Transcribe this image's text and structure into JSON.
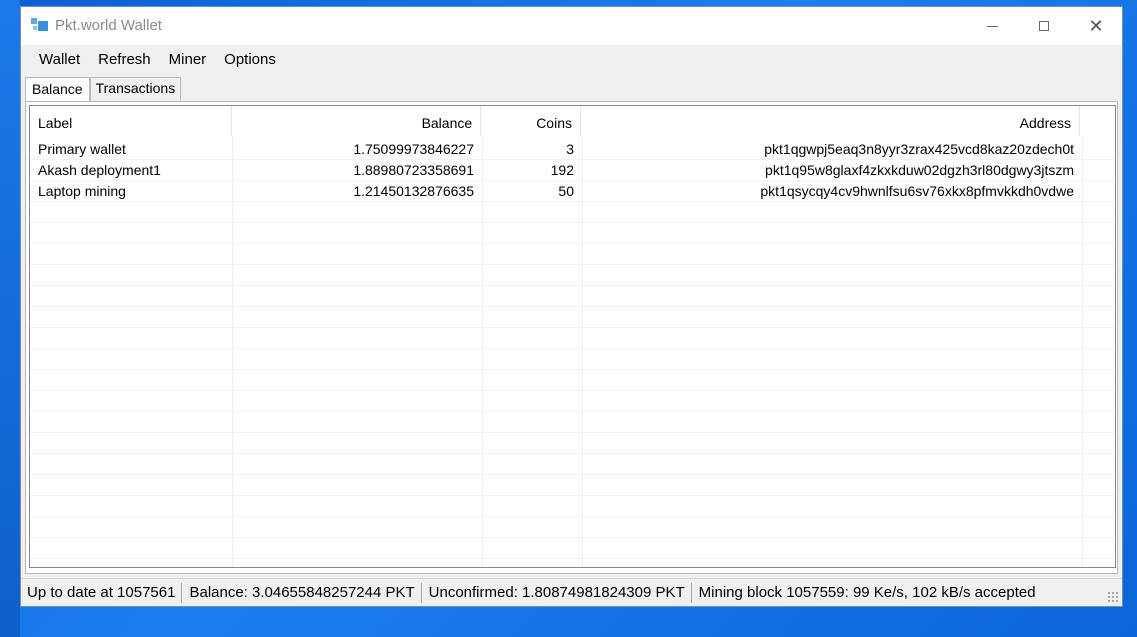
{
  "window": {
    "title": "Pkt.world Wallet"
  },
  "menu": {
    "items": [
      "Wallet",
      "Refresh",
      "Miner",
      "Options"
    ]
  },
  "tabs": [
    {
      "label": "Balance",
      "active": true
    },
    {
      "label": "Transactions",
      "active": false
    }
  ],
  "table": {
    "columns": [
      "Label",
      "Balance",
      "Coins",
      "Address"
    ],
    "rows": [
      {
        "label": "Primary wallet",
        "balance": "1.75099973846227",
        "coins": "3",
        "address": "pkt1qgwpj5eaq3n8yyr3zrax425vcd8kaz20zdech0t"
      },
      {
        "label": "Akash deployment1",
        "balance": "1.88980723358691",
        "coins": "192",
        "address": "pkt1q95w8glaxf4zkxkduw02dgzh3rl80dgwy3jtszm"
      },
      {
        "label": "Laptop mining",
        "balance": "1.21450132876635",
        "coins": "50",
        "address": "pkt1qsycqy4cv9hwnlfsu6sv76xkx8pfmvkkdh0vdwe"
      }
    ]
  },
  "status": {
    "sync": "Up to date at 1057561",
    "balance": "Balance: 3.04655848257244 PKT",
    "unconfirmed": "Unconfirmed: 1.80874981824309 PKT",
    "mining": "Mining block 1057559: 99 Ke/s, 102 kB/s accepted"
  },
  "icons": {
    "app": "wallet-app-icon",
    "minimize": "minimize-icon",
    "maximize": "maximize-icon",
    "close": "close-icon",
    "grip": "resize-grip-icon"
  }
}
